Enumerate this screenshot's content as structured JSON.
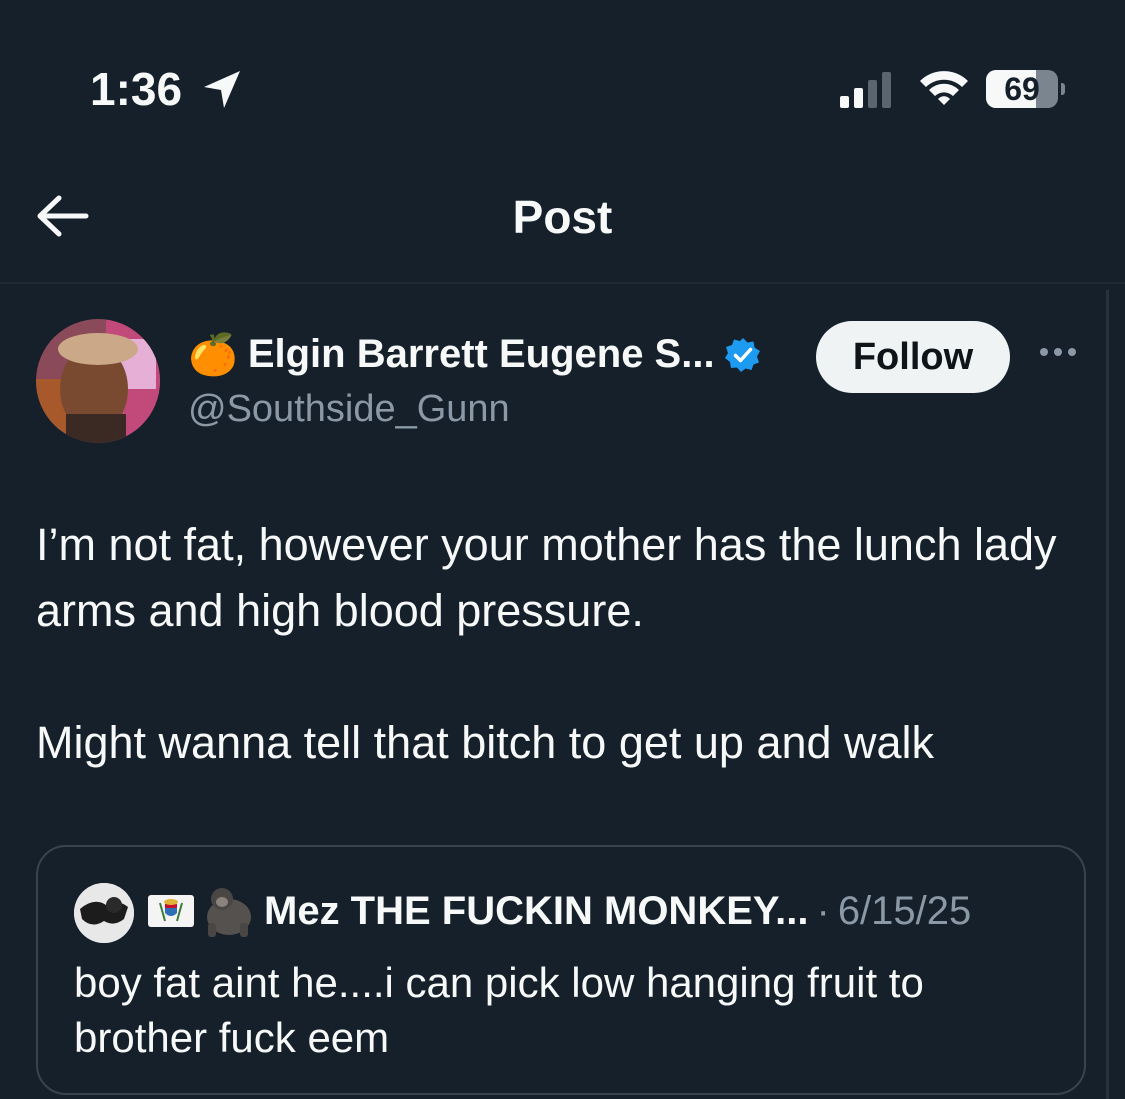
{
  "status_bar": {
    "time": "1:36",
    "battery": "69",
    "battery_level_percent": 69,
    "icons": [
      "location-arrow-icon",
      "cellular-signal-icon",
      "wifi-icon",
      "battery-icon"
    ]
  },
  "header": {
    "title": "Post",
    "back_icon": "back-arrow-icon"
  },
  "author": {
    "name_emoji": "🍊",
    "name": "Elgin Barrett Eugene S...",
    "verified_icon": "verified-badge-icon",
    "handle": "@Southside_Gunn",
    "follow_label": "Follow",
    "more_icon": "more-options-icon"
  },
  "post": {
    "paragraph_1": "I’m not fat, however your mother has the lunch lady arms and high blood pressure.",
    "paragraph_2": "Might wanna tell that bitch to get up and walk"
  },
  "quoted_post": {
    "name_emojis": [
      "🇻🇮",
      "🦍"
    ],
    "name": "Mez THE FUCKIN MONKEY...",
    "separator": "·",
    "date": "6/15/25",
    "text": "boy fat aint he....i can pick low hanging fruit to brother fuck eem"
  },
  "colors": {
    "background": "#15202b",
    "text": "#f7f9f9",
    "secondary_text": "#8b98a5",
    "verified_blue": "#1d9bf0",
    "follow_button_bg": "#eff3f4",
    "border": "#38444d"
  }
}
